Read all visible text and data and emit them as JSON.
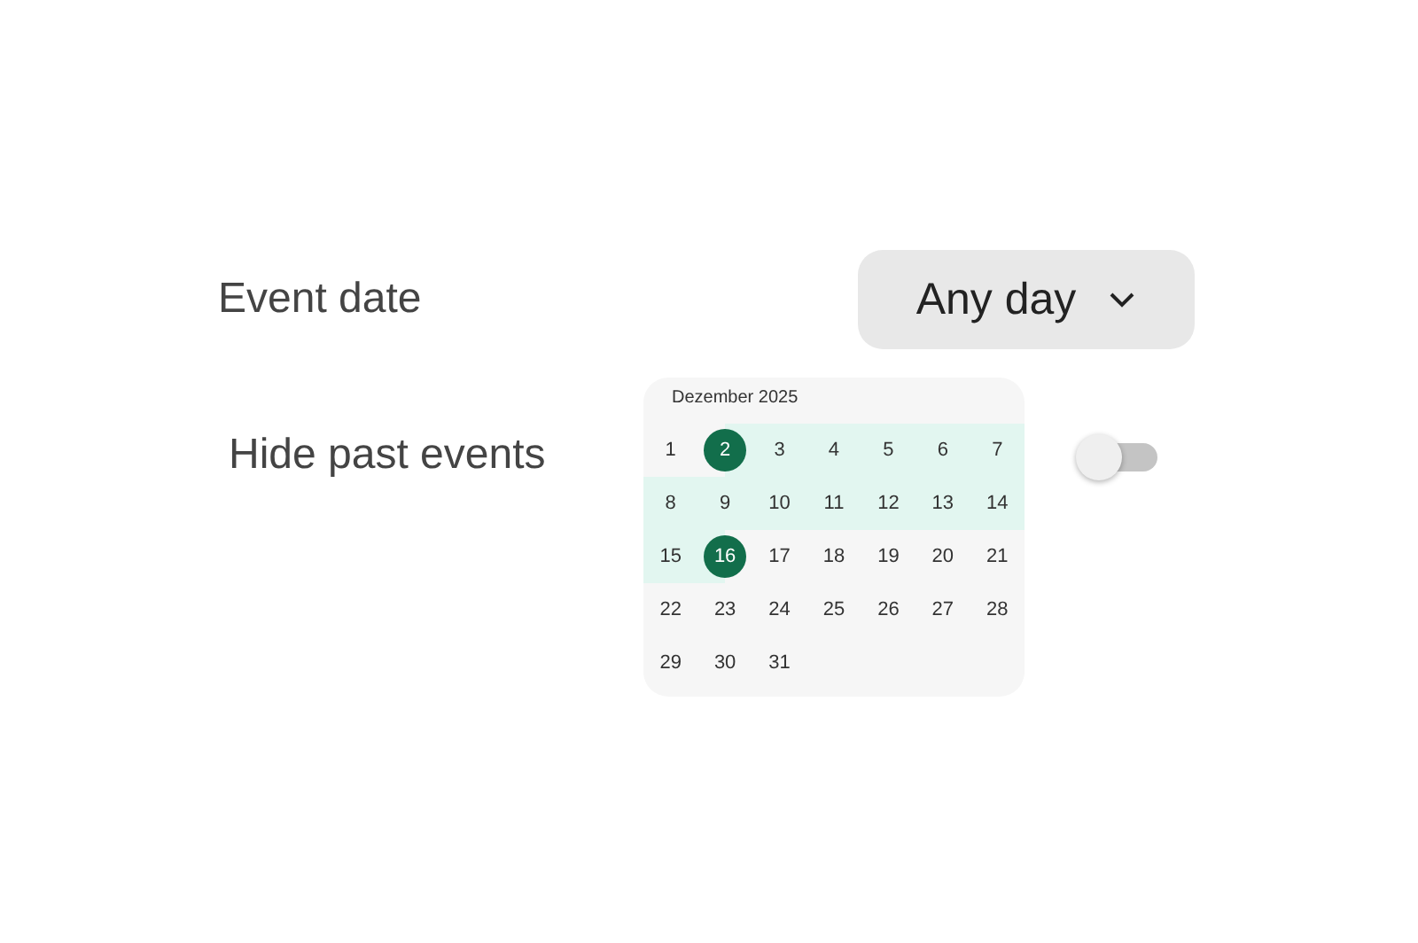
{
  "event_date": {
    "label": "Event date",
    "dropdown": {
      "value": "Any day"
    }
  },
  "hide_past": {
    "label": "Hide past events",
    "toggle": {
      "on": false
    }
  },
  "calendar": {
    "month": "Dezember 2025",
    "days": [
      {
        "day": "1",
        "selected": false,
        "in_range": false
      },
      {
        "day": "2",
        "selected": true,
        "in_range": false
      },
      {
        "day": "3",
        "selected": false,
        "in_range": true
      },
      {
        "day": "4",
        "selected": false,
        "in_range": true
      },
      {
        "day": "5",
        "selected": false,
        "in_range": true
      },
      {
        "day": "6",
        "selected": false,
        "in_range": true
      },
      {
        "day": "7",
        "selected": false,
        "in_range": true
      },
      {
        "day": "8",
        "selected": false,
        "in_range": true
      },
      {
        "day": "9",
        "selected": false,
        "in_range": true
      },
      {
        "day": "10",
        "selected": false,
        "in_range": true
      },
      {
        "day": "11",
        "selected": false,
        "in_range": true
      },
      {
        "day": "12",
        "selected": false,
        "in_range": true
      },
      {
        "day": "13",
        "selected": false,
        "in_range": true
      },
      {
        "day": "14",
        "selected": false,
        "in_range": true
      },
      {
        "day": "15",
        "selected": false,
        "in_range": true
      },
      {
        "day": "16",
        "selected": true,
        "in_range": false
      },
      {
        "day": "17",
        "selected": false,
        "in_range": false
      },
      {
        "day": "18",
        "selected": false,
        "in_range": false
      },
      {
        "day": "19",
        "selected": false,
        "in_range": false
      },
      {
        "day": "20",
        "selected": false,
        "in_range": false
      },
      {
        "day": "21",
        "selected": false,
        "in_range": false
      },
      {
        "day": "22",
        "selected": false,
        "in_range": false
      },
      {
        "day": "23",
        "selected": false,
        "in_range": false
      },
      {
        "day": "24",
        "selected": false,
        "in_range": false
      },
      {
        "day": "25",
        "selected": false,
        "in_range": false
      },
      {
        "day": "26",
        "selected": false,
        "in_range": false
      },
      {
        "day": "27",
        "selected": false,
        "in_range": false
      },
      {
        "day": "28",
        "selected": false,
        "in_range": false
      },
      {
        "day": "29",
        "selected": false,
        "in_range": false
      },
      {
        "day": "30",
        "selected": false,
        "in_range": false
      },
      {
        "day": "31",
        "selected": false,
        "in_range": false
      }
    ]
  }
}
